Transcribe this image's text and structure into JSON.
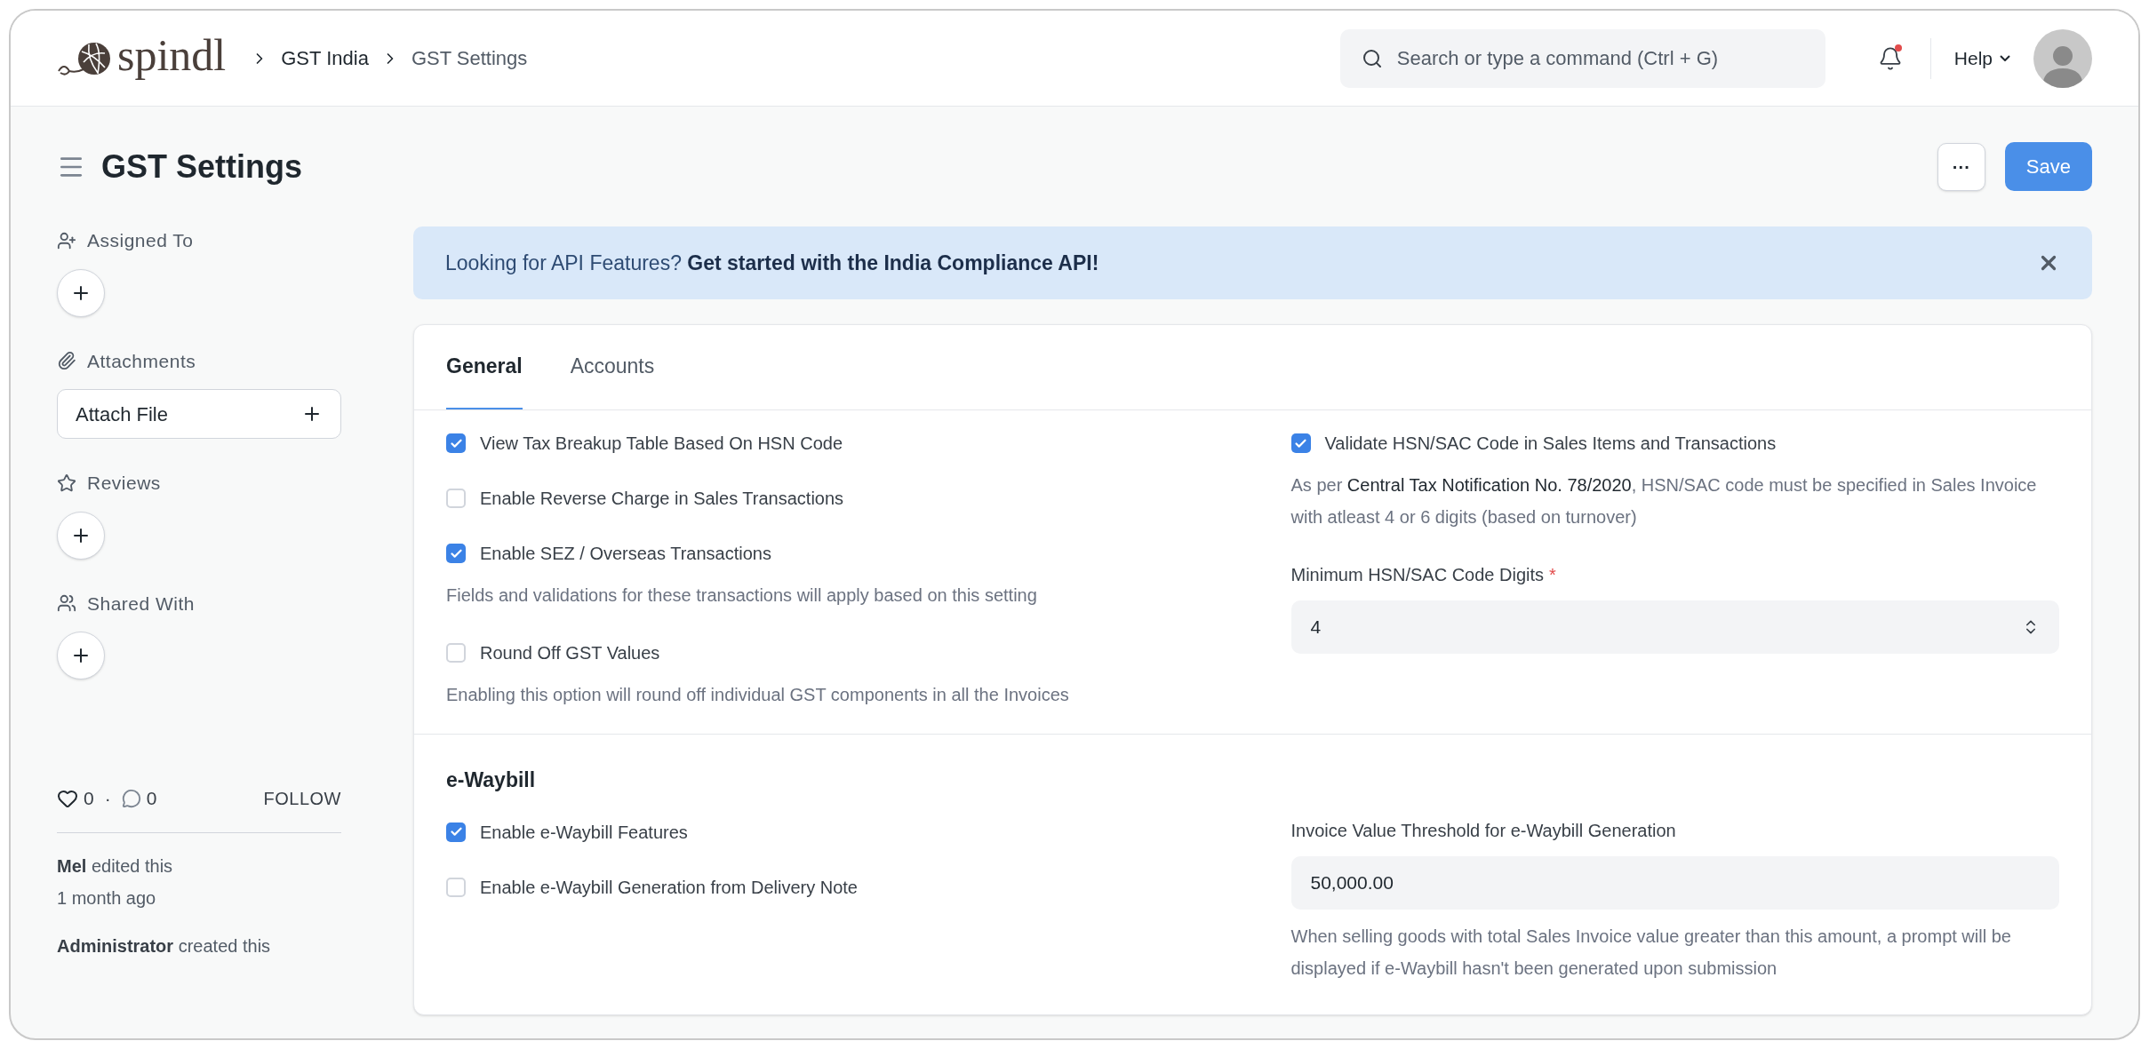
{
  "header": {
    "logo": "spindl",
    "breadcrumbs": [
      "GST India",
      "GST Settings"
    ],
    "search": {
      "placeholder": "Search or type a command (Ctrl + G)"
    },
    "notifications": {
      "unread": true
    },
    "help": "Help"
  },
  "page": {
    "title": "GST Settings",
    "more": "···",
    "save": "Save"
  },
  "sidebar": {
    "sections": [
      {
        "kind": "assign",
        "label": "Assigned To"
      },
      {
        "kind": "attach",
        "label": "Attachments",
        "button": "Attach File"
      },
      {
        "kind": "review",
        "label": "Reviews"
      },
      {
        "kind": "share",
        "label": "Shared With"
      }
    ],
    "likes": "0",
    "separator": "·",
    "comments": "0",
    "follow": "FOLLOW",
    "activity": [
      {
        "text": "**Mel** edited this",
        "time": "1 month ago"
      },
      {
        "text": "**Administrator** created this"
      }
    ]
  },
  "banner": {
    "text": "Looking for API Features? **Get started with the India Compliance API!**",
    "dismissible": true
  },
  "tabs": [
    {
      "label": "General",
      "selected": true
    },
    {
      "label": "Accounts",
      "selected": false
    }
  ],
  "sections": [
    {
      "left": [
        {
          "kind": "checkbox",
          "label": "View Tax Breakup Table Based On HSN Code",
          "checked": true
        },
        {
          "kind": "checkbox",
          "label": "Enable Reverse Charge in Sales Transactions",
          "checked": false
        },
        {
          "kind": "checkbox",
          "label": "Enable SEZ / Overseas Transactions",
          "checked": true,
          "description": "Fields and validations for these transactions will apply based on this setting"
        },
        {
          "kind": "checkbox",
          "label": "Round Off GST Values",
          "checked": false,
          "description": "Enabling this option will round off individual GST components in all the Invoices"
        }
      ],
      "right": [
        {
          "kind": "checkbox",
          "label": "Validate HSN/SAC Code in Sales Items and Transactions",
          "checked": true,
          "description": "As per **Central Tax Notification No. 78/2020**, HSN/SAC code must be specified in Sales Invoice with atleast 4 or 6 digits (based on turnover)"
        },
        {
          "kind": "select",
          "label": "Minimum HSN/SAC Code Digits",
          "required_mark": "*",
          "value": "4"
        }
      ]
    },
    {
      "title": "e-Waybill",
      "left": [
        {
          "kind": "checkbox",
          "label": "Enable e-Waybill Features",
          "checked": true
        },
        {
          "kind": "checkbox",
          "label": "Enable e-Waybill Generation from Delivery Note",
          "checked": false
        }
      ],
      "right": [
        {
          "kind": "data",
          "label": "Invoice Value Threshold for e-Waybill Generation",
          "value": "50,000.00",
          "description": "When selling goods with total Sales Invoice value greater than this amount, a prompt will be displayed if e-Waybill hasn't been generated upon submission"
        }
      ]
    }
  ]
}
